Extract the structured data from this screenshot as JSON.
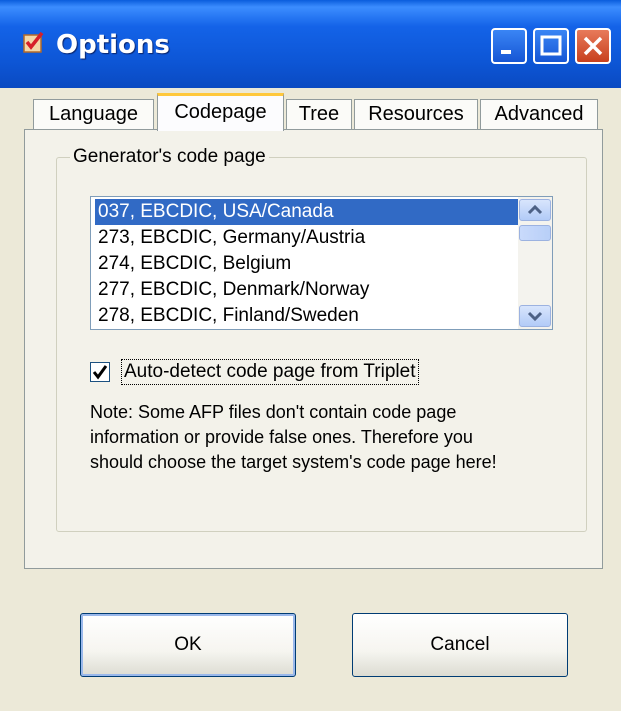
{
  "window": {
    "title": "Options"
  },
  "tabs": [
    {
      "label": "Language"
    },
    {
      "label": "Codepage",
      "active": true
    },
    {
      "label": "Tree"
    },
    {
      "label": "Resources"
    },
    {
      "label": "Advanced"
    }
  ],
  "group": {
    "label": "Generator's code page"
  },
  "codepages": {
    "items": [
      "037, EBCDIC, USA/Canada",
      "273, EBCDIC, Germany/Austria",
      "274, EBCDIC, Belgium",
      "277, EBCDIC, Denmark/Norway",
      "278, EBCDIC, Finland/Sweden"
    ],
    "selected": "037, EBCDIC, USA/Canada"
  },
  "auto_detect": {
    "label": "Auto-detect code page from Triplet",
    "checked": true
  },
  "note": {
    "lines": [
      "Note: Some AFP files don't contain code page",
      "information or provide false ones. Therefore you",
      "should choose the target system's code page here!"
    ]
  },
  "buttons": {
    "ok": "OK",
    "cancel": "Cancel"
  },
  "colors": {
    "titlebar": "#0a5ddc",
    "selection": "#316ac5",
    "tab_accent": "#ffc83c"
  }
}
